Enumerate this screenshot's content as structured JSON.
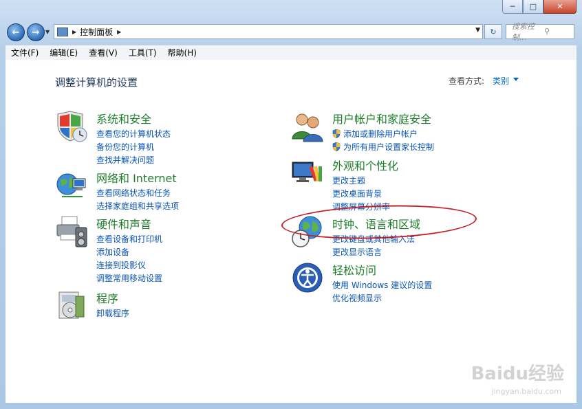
{
  "window": {
    "minimize_icon": "minimize-icon",
    "maximize_icon": "maximize-icon",
    "close_icon": "close-icon"
  },
  "navigation": {
    "address_path": "控制面板",
    "search_placeholder": "搜索控制...",
    "back_icon": "back-arrow-icon",
    "forward_icon": "forward-arrow-icon"
  },
  "menubar": {
    "items": [
      "文件(F)",
      "编辑(E)",
      "查看(V)",
      "工具(T)",
      "帮助(H)"
    ]
  },
  "page": {
    "title": "调整计算机的设置",
    "view_by_label": "查看方式:",
    "view_by_value": "类别"
  },
  "categories": [
    {
      "title": "系统和安全",
      "icon": "shield-clock-icon",
      "links": [
        "查看您的计算机状态",
        "备份您的计算机",
        "查找并解决问题"
      ]
    },
    {
      "title": "网络和 Internet",
      "icon": "globe-network-icon",
      "links": [
        "查看网络状态和任务",
        "选择家庭组和共享选项"
      ]
    },
    {
      "title": "硬件和声音",
      "icon": "printer-speaker-icon",
      "links": [
        "查看设备和打印机",
        "添加设备",
        "连接到投影仪",
        "调整常用移动设置"
      ]
    },
    {
      "title": "程序",
      "icon": "programs-disc-icon",
      "links": [
        "卸载程序"
      ]
    },
    {
      "title": "用户帐户和家庭安全",
      "icon": "users-icon",
      "links": [
        "添加或删除用户帐户",
        "为所有用户设置家长控制"
      ]
    },
    {
      "title": "外观和个性化",
      "icon": "monitor-palette-icon",
      "links": [
        "更改主题",
        "更改桌面背景",
        "调整屏幕分辨率"
      ]
    },
    {
      "title": "时钟、语言和区域",
      "icon": "clock-globe-icon",
      "links": [
        "更改键盘或其他输入法",
        "更改显示语言"
      ]
    },
    {
      "title": "轻松访问",
      "icon": "ease-of-access-icon",
      "links": [
        "使用 Windows 建议的设置",
        "优化视频显示"
      ]
    }
  ],
  "watermark": {
    "text": "Baidu经验",
    "sub": "jingyan.baidu.com"
  },
  "colors": {
    "category_title": "#1e7d2b",
    "link": "#0a56b5",
    "highlight": "#c4202a"
  }
}
